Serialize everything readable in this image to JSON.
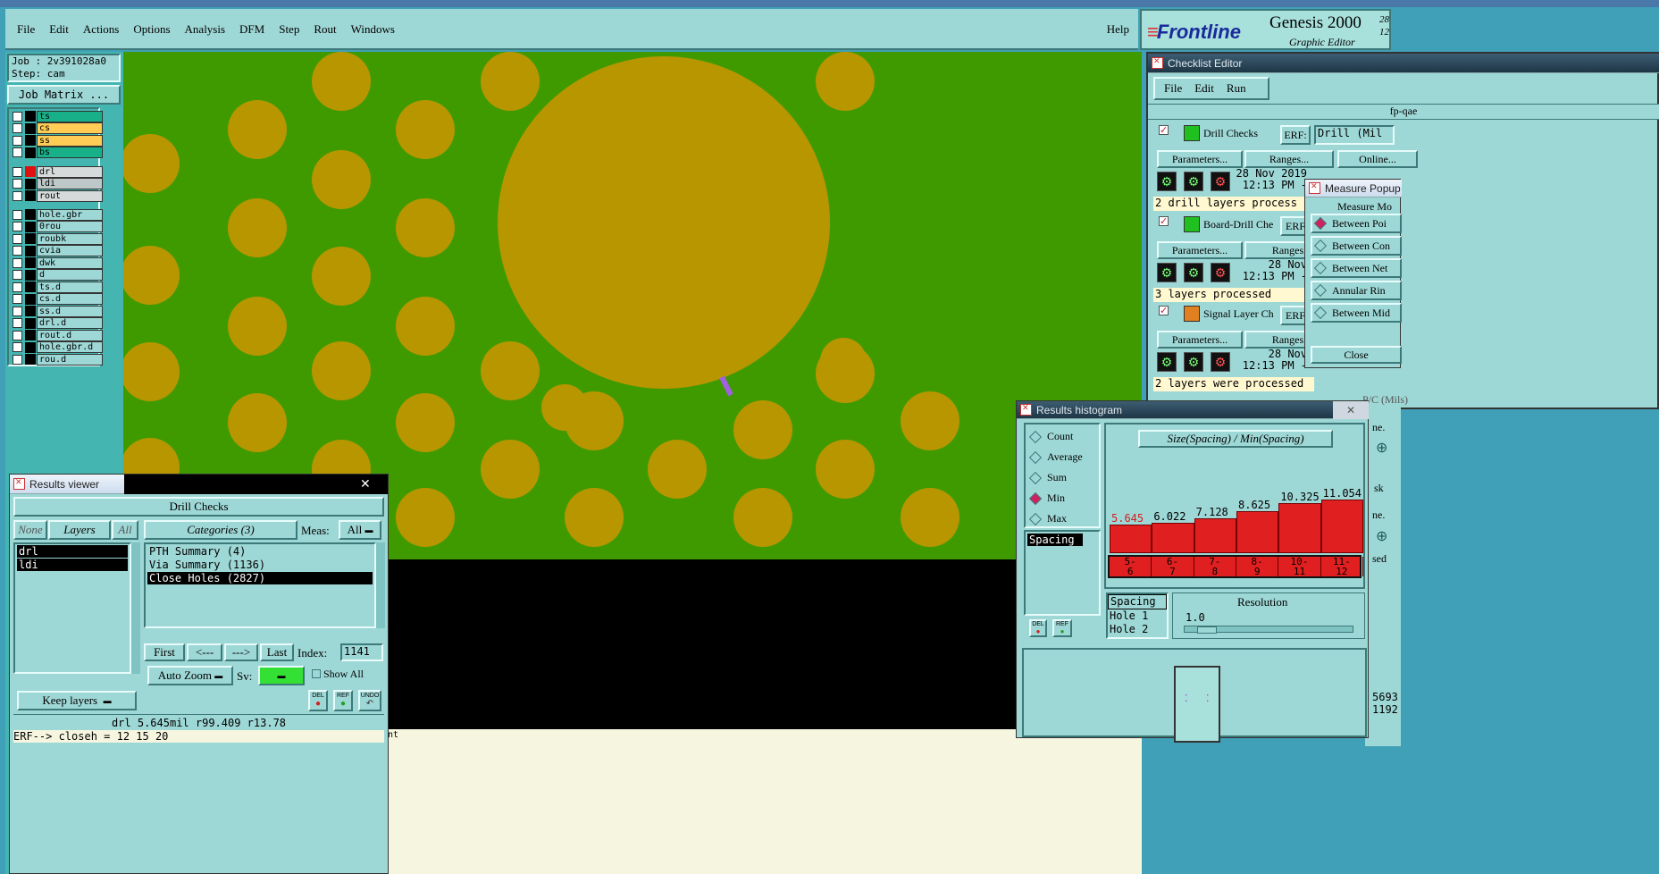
{
  "menu": {
    "items": [
      "File",
      "Edit",
      "Actions",
      "Options",
      "Analysis",
      "DFM",
      "Step",
      "Rout",
      "Windows"
    ],
    "help": "Help"
  },
  "brand": {
    "logo": "Frontline",
    "product": "Genesis 2000",
    "subtitle": "Graphic Editor",
    "version_a": "28",
    "version_b": "12"
  },
  "job": {
    "job_label": "Job : 2v391028a0",
    "step_label": "Step: cam",
    "matrix_button": "Job Matrix ..."
  },
  "layers": [
    {
      "name": "ts",
      "color": "#18b088"
    },
    {
      "name": "cs",
      "color": "#ffcc55"
    },
    {
      "name": "ss",
      "color": "#ffcc55"
    },
    {
      "name": "bs",
      "color": "#18b088"
    },
    {
      "name": "drl",
      "color": "#d6dada"
    },
    {
      "name": "ldi",
      "color": "#bfc8c8"
    },
    {
      "name": "rout",
      "color": "#d6dada"
    },
    {
      "name": "hole.gbr",
      "color": "#9ed8d6"
    },
    {
      "name": "0rou",
      "color": "#9ed8d6"
    },
    {
      "name": "roubk",
      "color": "#9ed8d6"
    },
    {
      "name": "cvia",
      "color": "#9ed8d6"
    },
    {
      "name": "dwk",
      "color": "#9ed8d6"
    },
    {
      "name": "d",
      "color": "#9ed8d6"
    },
    {
      "name": "ts.d",
      "color": "#9ed8d6"
    },
    {
      "name": "cs.d",
      "color": "#9ed8d6"
    },
    {
      "name": "ss.d",
      "color": "#9ed8d6"
    },
    {
      "name": "drl.d",
      "color": "#9ed8d6"
    },
    {
      "name": "rout.d",
      "color": "#9ed8d6"
    },
    {
      "name": "hole.gbr.d",
      "color": "#9ed8d6"
    },
    {
      "name": "rou.d",
      "color": "#9ed8d6"
    }
  ],
  "canvas": {
    "background": "#3f9a00",
    "pad_color": "#b89600",
    "marker_color": "#a060e0"
  },
  "results_viewer": {
    "title": "Results viewer",
    "header": "Drill Checks",
    "none": "None",
    "layers": "Layers",
    "all": "All",
    "categories": "Categories (3)",
    "meas_label": "Meas:",
    "meas_value": "All",
    "layer_list": [
      "drl",
      "ldi"
    ],
    "category_list": [
      "PTH Summary (4)",
      "Via Summary (1136)",
      "Close Holes (2827)"
    ],
    "first": "First",
    "prev": "<---",
    "next": "--->",
    "last": "Last",
    "index_label": "Index:",
    "index_value": "1141",
    "auto_zoom": "Auto Zoom",
    "sv_label": "Sv:",
    "show_all": "Show All",
    "keep_layers": "Keep layers",
    "del": "DEL",
    "ref": "REF",
    "undo": "UNDO",
    "status": "drl  5.645mil   r99.409  r13.78",
    "erf_line": "ERF--> closeh = 12 15 20",
    "trail": "nt"
  },
  "checklist": {
    "title": "Checklist Editor",
    "menu": [
      "File",
      "Edit",
      "Run"
    ],
    "name": "fp-qae",
    "checks": [
      {
        "name": "Drill Checks",
        "erf": "ERF:",
        "erf_value": "Drill (Mil",
        "params": "Parameters...",
        "ranges": "Ranges...",
        "online": "Online...",
        "date": "28 Nov 2019",
        "time": "12:13 PM -",
        "result": "2 drill layers process"
      },
      {
        "name": "Board-Drill Che",
        "erf": "ERF",
        "params": "Parameters...",
        "ranges": "Ranges.",
        "date": "28 Nov",
        "time": "12:13 PM -",
        "result": "3 layers processed"
      },
      {
        "name": "Signal Layer Ch",
        "erf": "ERF",
        "params": "Parameters...",
        "ranges": "Ranges.",
        "date": "28 Nov",
        "time": "12:13 PM -",
        "result": "2 layers were processed"
      }
    ],
    "partial_erf": "P/C (Mils)",
    "side_a": "ne.",
    "side_b": "sk",
    "side_c": "ne.",
    "side_d": "sed",
    "num_a": "5693",
    "num_b": "1192"
  },
  "measure": {
    "title": "Measure Popup",
    "header": "Measure Mo",
    "options": [
      "Between Poi",
      "Between Con",
      "Between Net",
      "Annular Rin",
      "Between Mid"
    ],
    "selected": 0,
    "close": "Close"
  },
  "histogram": {
    "title": "Results histogram",
    "modes": [
      "Count",
      "Average",
      "Sum",
      "Min",
      "Max"
    ],
    "selected_mode": 3,
    "list_item": "Spacing",
    "chart_title": "Size(Spacing) / Min(Spacing)",
    "del": "DEL",
    "ref": "REF",
    "bins": [
      {
        "range_top": "5-",
        "range_bot": "6",
        "value": "5.645",
        "v": 5.645,
        "highlight": true
      },
      {
        "range_top": "6-",
        "range_bot": "7",
        "value": "6.022",
        "v": 6.022,
        "highlight": false
      },
      {
        "range_top": "7-",
        "range_bot": "8",
        "value": "7.128",
        "v": 7.128,
        "highlight": false
      },
      {
        "range_top": "8-",
        "range_bot": "9",
        "value": "8.625",
        "v": 8.625,
        "highlight": false
      },
      {
        "range_top": "10-",
        "range_bot": "11",
        "value": "10.325",
        "v": 10.325,
        "highlight": false
      },
      {
        "range_top": "11-",
        "range_bot": "12",
        "value": "11.054",
        "v": 11.054,
        "highlight": false
      }
    ],
    "sub_list": [
      "Spacing",
      "Hole 1",
      "Hole 2"
    ],
    "resolution_label": "Resolution",
    "resolution_value": "1.0"
  }
}
